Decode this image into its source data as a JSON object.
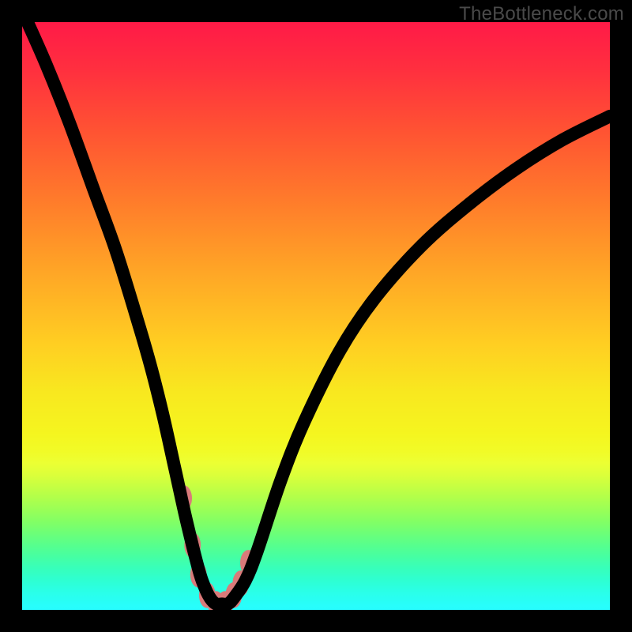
{
  "watermark": "TheBottleneck.com",
  "chart_data": {
    "type": "line",
    "title": "",
    "xlabel": "",
    "ylabel": "",
    "xlim": [
      0,
      100
    ],
    "ylim": [
      0,
      100
    ],
    "series": [
      {
        "name": "bottleneck-curve",
        "x": [
          0,
          4,
          8,
          12,
          16,
          20,
          22,
          24,
          26,
          28,
          30,
          31,
          32,
          33,
          34,
          35,
          36,
          38,
          40,
          44,
          48,
          54,
          60,
          68,
          76,
          84,
          92,
          100
        ],
        "values": [
          102,
          93,
          83,
          72,
          61,
          48,
          41,
          33,
          24,
          15,
          7,
          4,
          2,
          1,
          1,
          1,
          2,
          5,
          10,
          22,
          32,
          44,
          53,
          62,
          69,
          75,
          80,
          84
        ]
      }
    ],
    "markers": {
      "name": "highlighted-range",
      "x": [
        27.5,
        29.0,
        30.0,
        31.5,
        33.0,
        34.5,
        36.0,
        37.2,
        38.5
      ],
      "values": [
        19.0,
        11.0,
        6.0,
        2.5,
        1.0,
        1.0,
        2.5,
        4.5,
        8.0
      ],
      "rx": 1.4,
      "ry": 2.2
    }
  }
}
